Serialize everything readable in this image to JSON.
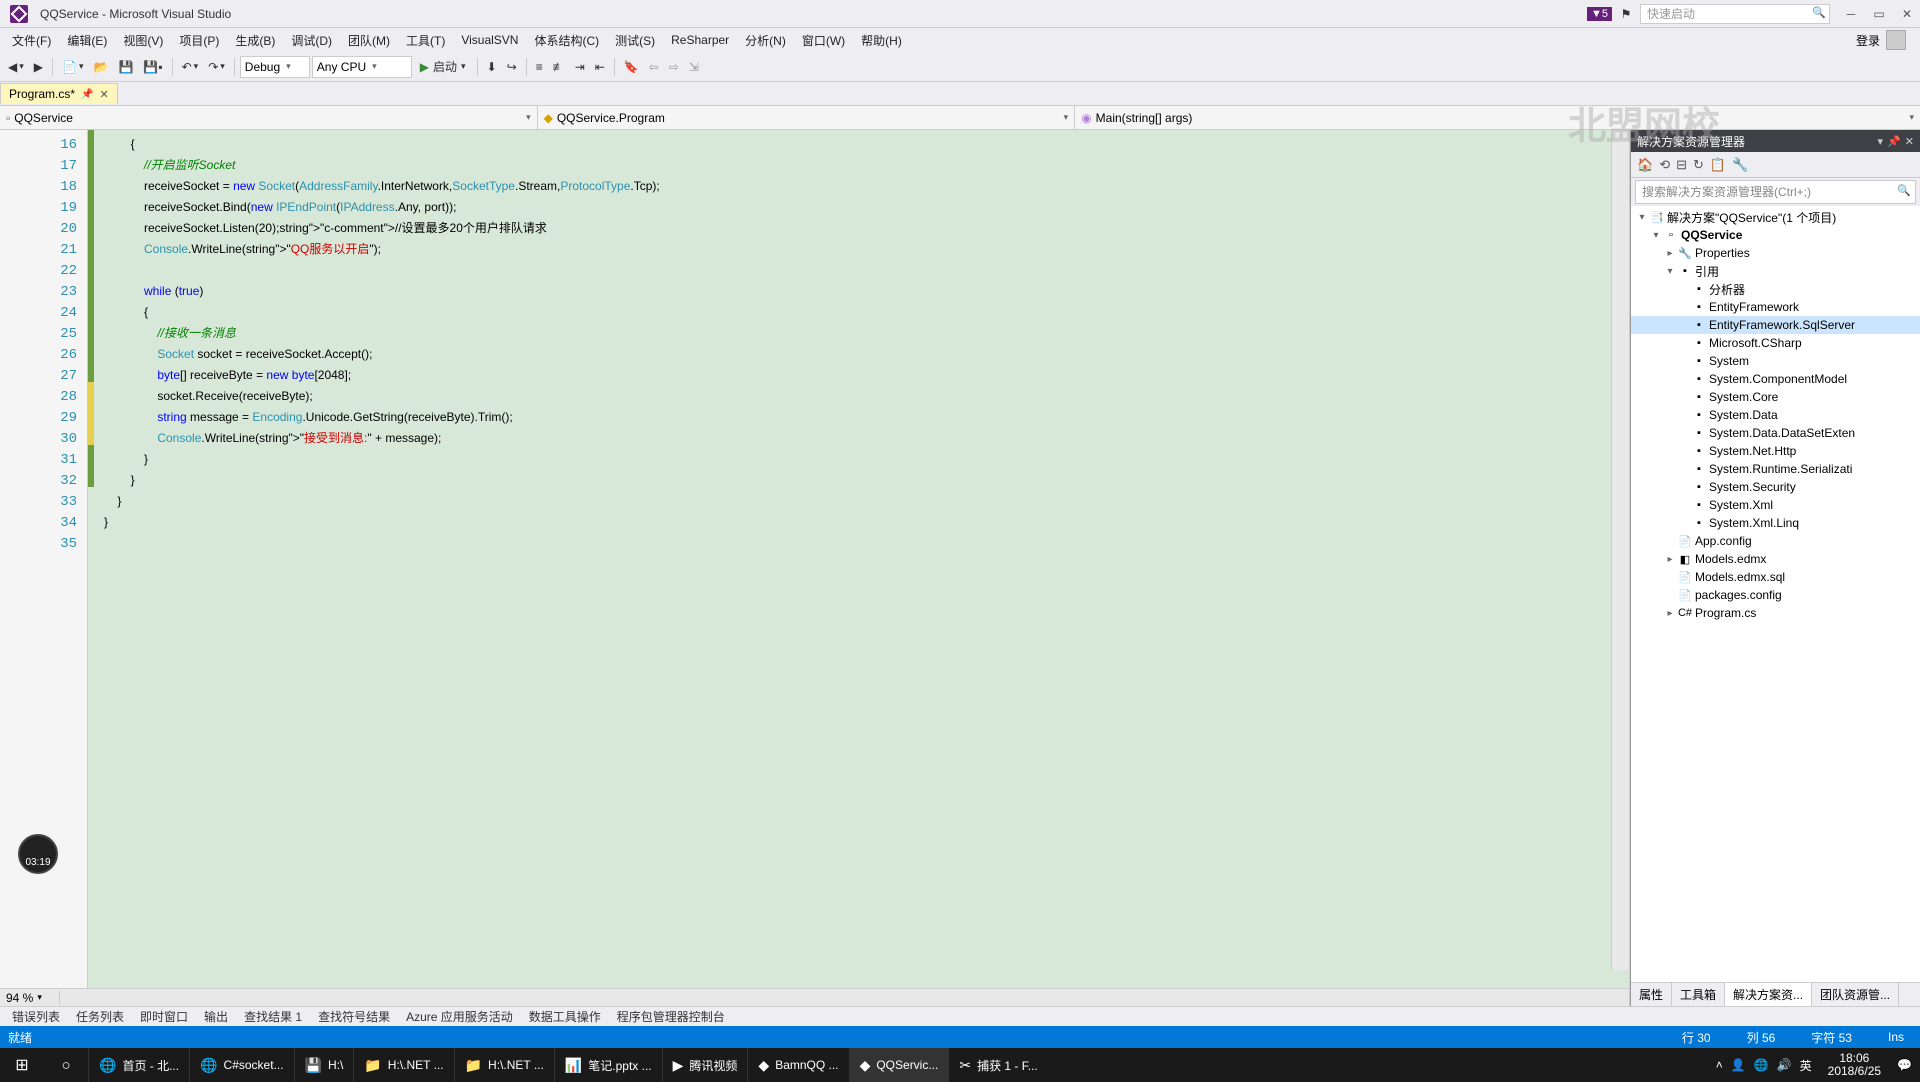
{
  "title": "QQService - Microsoft Visual Studio",
  "badge": "▼5",
  "quick_launch_placeholder": "快速启动",
  "login_label": "登录",
  "menus": [
    "文件(F)",
    "编辑(E)",
    "视图(V)",
    "项目(P)",
    "生成(B)",
    "调试(D)",
    "团队(M)",
    "工具(T)",
    "VisualSVN",
    "体系结构(C)",
    "测试(S)",
    "ReSharper",
    "分析(N)",
    "窗口(W)",
    "帮助(H)"
  ],
  "toolbar": {
    "config": "Debug",
    "platform": "Any CPU",
    "start": "启动"
  },
  "doc_tab": {
    "name": "Program.cs*"
  },
  "nav": {
    "project": "QQService",
    "class": "QQService.Program",
    "member": "Main(string[] args)"
  },
  "zoom": "94 %",
  "code": {
    "lines": [
      {
        "n": 16,
        "txt": "        {",
        "mark": "green"
      },
      {
        "n": 17,
        "txt": "            //开启监听Socket",
        "mark": "green",
        "comment": true
      },
      {
        "n": 18,
        "txt": "            receiveSocket = new Socket(AddressFamily.InterNetwork,SocketType.Stream,ProtocolType.Tcp);",
        "mark": "green"
      },
      {
        "n": 19,
        "txt": "            receiveSocket.Bind(new IPEndPoint(IPAddress.Any, port));",
        "mark": "green"
      },
      {
        "n": 20,
        "txt": "            receiveSocket.Listen(20);//设置最多20个用户排队请求",
        "mark": "green"
      },
      {
        "n": 21,
        "txt": "            Console.WriteLine(\"QQ服务以开启\");",
        "mark": "green"
      },
      {
        "n": 22,
        "txt": "",
        "mark": "green"
      },
      {
        "n": 23,
        "txt": "            while (true)",
        "mark": "green"
      },
      {
        "n": 24,
        "txt": "            {",
        "mark": "green"
      },
      {
        "n": 25,
        "txt": "                //接收一条消息",
        "mark": "green",
        "comment": true
      },
      {
        "n": 26,
        "txt": "                Socket socket = receiveSocket.Accept();",
        "mark": "green"
      },
      {
        "n": 27,
        "txt": "                byte[] receiveByte = new byte[2048];",
        "mark": "green"
      },
      {
        "n": 28,
        "txt": "                socket.Receive(receiveByte);",
        "mark": "yellow"
      },
      {
        "n": 29,
        "txt": "                string message = Encoding.Unicode.GetString(receiveByte).Trim();",
        "mark": "yellow"
      },
      {
        "n": 30,
        "txt": "                Console.WriteLine(\"接受到消息:\" + message);",
        "mark": "yellow"
      },
      {
        "n": 31,
        "txt": "            }",
        "mark": "green"
      },
      {
        "n": 32,
        "txt": "        }",
        "mark": "green"
      },
      {
        "n": 33,
        "txt": "    }",
        "mark": ""
      },
      {
        "n": 34,
        "txt": "}",
        "mark": ""
      },
      {
        "n": 35,
        "txt": "",
        "mark": ""
      }
    ]
  },
  "solution": {
    "panel_title": "解决方案资源管理器",
    "search_placeholder": "搜索解决方案资源管理器(Ctrl+;)",
    "root": "解决方案\"QQService\"(1 个项目)",
    "project": "QQService",
    "nodes": {
      "properties": "Properties",
      "refs": "引用",
      "refs_children": [
        "分析器",
        "EntityFramework",
        "EntityFramework.SqlServer",
        "Microsoft.CSharp",
        "System",
        "System.ComponentModel",
        "System.Core",
        "System.Data",
        "System.Data.DataSetExten",
        "System.Net.Http",
        "System.Runtime.Serializati",
        "System.Security",
        "System.Xml",
        "System.Xml.Linq"
      ],
      "files": [
        "App.config",
        "Models.edmx",
        "Models.edmx.sql",
        "packages.config",
        "Program.cs"
      ]
    },
    "bottom_tabs": [
      "属性",
      "工具箱",
      "解决方案资...",
      "团队资源管..."
    ]
  },
  "bottom_tabs": [
    "错误列表",
    "任务列表",
    "即时窗口",
    "输出",
    "查找结果 1",
    "查找符号结果",
    "Azure 应用服务活动",
    "数据工具操作",
    "程序包管理器控制台"
  ],
  "status": {
    "ready": "就绪",
    "line": "行 30",
    "col": "列 56",
    "char": "字符 53",
    "ins": "Ins"
  },
  "taskbar": {
    "items": [
      {
        "icon": "🌐",
        "label": "首页 - 北..."
      },
      {
        "icon": "🌐",
        "label": "C#socket..."
      },
      {
        "icon": "💾",
        "label": "H:\\"
      },
      {
        "icon": "📁",
        "label": "H:\\.NET ..."
      },
      {
        "icon": "📁",
        "label": "H:\\.NET ..."
      },
      {
        "icon": "📊",
        "label": "笔记.pptx ..."
      },
      {
        "icon": "▶",
        "label": "腾讯视频"
      },
      {
        "icon": "◆",
        "label": "BamnQQ ..."
      },
      {
        "icon": "◆",
        "label": "QQServic...",
        "active": true
      },
      {
        "icon": "✂",
        "label": "捕获 1 - F..."
      }
    ],
    "ime": "英",
    "time": "18:06",
    "date": "2018/6/25"
  },
  "watermark": "北盟网校",
  "timer": "03:19"
}
